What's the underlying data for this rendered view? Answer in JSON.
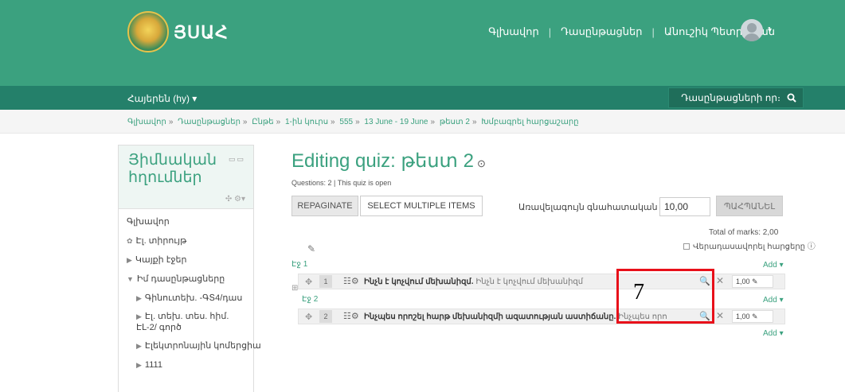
{
  "header": {
    "site_name": "ՅՍԱՀ",
    "nav": [
      "Գլխավոր",
      "Դասընթացներ"
    ],
    "user_name": "Անուշիկ Պետրոսյան",
    "caret": "▾"
  },
  "subnav": {
    "language": "Հայերեն (hy) ▾",
    "course_search": "Դասընթացների որ։"
  },
  "breadcrumb": [
    "Գլխավոր",
    "Դասընթացներ",
    "Ընթե",
    "1-ին կուրս",
    "555",
    "13 June - 19 June",
    "թեստ 2",
    "Խմբագրել հարցաշարը"
  ],
  "sidebar": {
    "title": "Յիմնական հղումներ",
    "items": [
      {
        "label": "Գլխավոր",
        "indent": 1
      },
      {
        "label": "Էլ. տիրույթ",
        "indent": 1
      },
      {
        "label": "Կայքի էջեր",
        "indent": 1,
        "arrow": "▶"
      },
      {
        "label": "Իմ դասընթացները",
        "indent": 1,
        "arrow": "▼"
      },
      {
        "label": "Գինուտեխ. -ԳՏ4/դաս",
        "indent": 2,
        "arrow": "▶"
      },
      {
        "label": "Էլ. տեխ. տես. հիմ. ԷԼ-2/ գործ",
        "indent": 2,
        "arrow": "▶"
      },
      {
        "label": "Էլեկտրոնային կոմերցիա",
        "indent": 2,
        "arrow": "▶"
      },
      {
        "label": "1111",
        "indent": 2,
        "arrow": "▶"
      }
    ]
  },
  "main": {
    "title": "Editing quiz: թեստ 2",
    "info": "Questions: 2 | This quiz is open",
    "repaginate": "REPAGINATE",
    "select_multiple": "SELECT MULTIPLE ITEMS",
    "max_grade_label": "Առավելագույն գնահատական",
    "max_grade_value": "10,00",
    "save": "ՊԱՀՊԱՆԵԼ",
    "total_marks": "Total of marks: 2,00",
    "shuffle": "Վերադասավորել հարցերը",
    "add": "Add ▾"
  },
  "questions": [
    {
      "page": "Էջ 1",
      "number": "1",
      "name": "Ինչն է կոչվում մեխանիզմ.",
      "text": "Ինչն է կոչվում մեխանիզմ",
      "mark": "1,00"
    },
    {
      "page": "Էջ 2",
      "number": "2",
      "name": "Ինչպես որոշել հարթ մեխանիզմի ազատության աստիճանը.",
      "text": "Ինչպես որոշ...",
      "mark": "1,00"
    }
  ],
  "annotation": {
    "label": "7",
    "color": "#e8101a"
  },
  "colors": {
    "brand": "#3ba17f",
    "brand_dark": "#24806a"
  }
}
